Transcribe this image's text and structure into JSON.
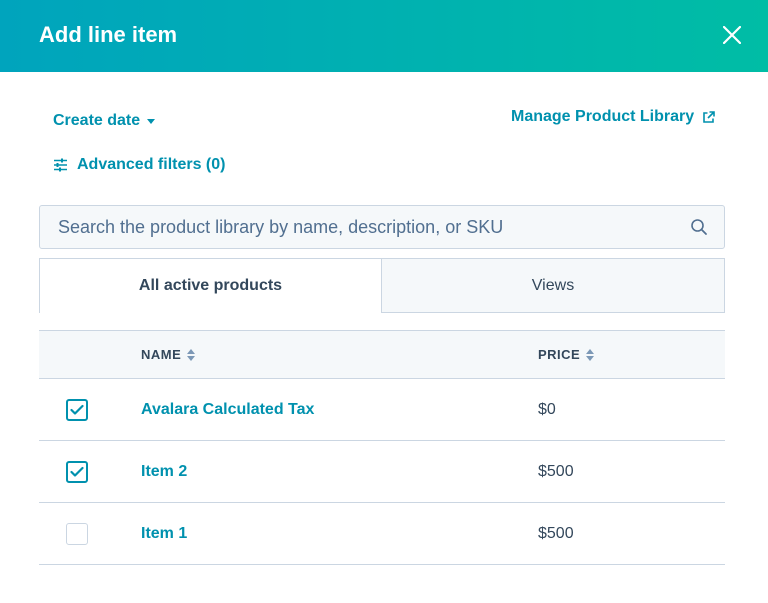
{
  "header": {
    "title": "Add line item",
    "close_icon": "close-icon",
    "gradient_start": "#00a4bd",
    "gradient_end": "#00bda5"
  },
  "toolbar": {
    "sort_label": "Create date",
    "manage_link": "Manage Product Library",
    "advanced_filters": "Advanced filters (0)"
  },
  "search": {
    "placeholder": "Search the product library by name, description, or SKU",
    "value": ""
  },
  "tabs": [
    {
      "label": "All active products",
      "active": true
    },
    {
      "label": "Views",
      "active": false
    }
  ],
  "table": {
    "columns": [
      "NAME",
      "PRICE"
    ],
    "rows": [
      {
        "name": "Avalara Calculated Tax",
        "price": "$0",
        "checked": true
      },
      {
        "name": "Item 2",
        "price": "$500",
        "checked": true
      },
      {
        "name": "Item 1",
        "price": "$500",
        "checked": false
      }
    ]
  },
  "colors": {
    "accent": "#0091ae",
    "text": "#33475b",
    "border": "#cbd6e2",
    "muted_bg": "#f5f8fa"
  }
}
